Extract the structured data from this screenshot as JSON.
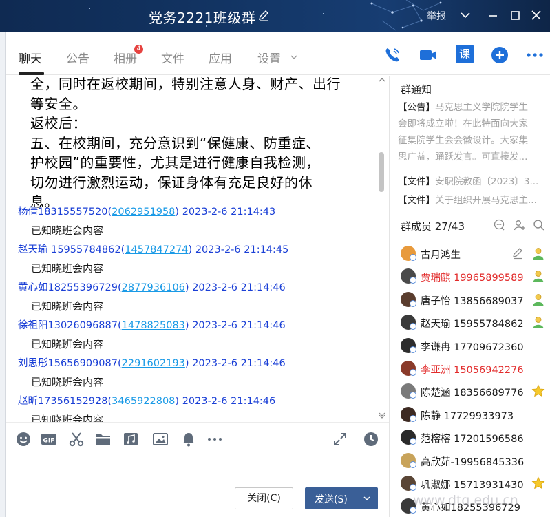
{
  "window": {
    "title": "党务2221班级群",
    "report_label": "举报"
  },
  "tabs": [
    {
      "label": "聊天",
      "active": true
    },
    {
      "label": "公告"
    },
    {
      "label": "相册",
      "badge": "4"
    },
    {
      "label": "文件"
    },
    {
      "label": "应用"
    },
    {
      "label": "设置"
    }
  ],
  "toolbar": {
    "class_label": "课"
  },
  "document_lines": [
    "全，同时在返校期间，特别注意人身、财产、出行",
    "等安全。",
    "返校后：",
    "五、在校期间，充分意识到“保健康、防重症、",
    "护校园”的重要性，尤其是进行健康自我检测，",
    "切勿进行激烈运动，保证身体有充足良好的休",
    "息。"
  ],
  "messages": [
    {
      "sender": "杨倩18315557520",
      "qq": "2062951958",
      "time": "2023-2-6 21:14:43",
      "text": "已知晓班会内容"
    },
    {
      "sender": "赵天瑜 15955784862",
      "qq": "1457847274",
      "time": "2023-2-6 21:14:45",
      "text": "已知晓班会内容"
    },
    {
      "sender": "黄心如18255396729",
      "qq": "2877936106",
      "time": "2023-2-6 21:14:46",
      "text": "已知晓班会内容"
    },
    {
      "sender": "徐祖阳13026096887",
      "qq": "1478825083",
      "time": "2023-2-6 21:14:46",
      "text": "已知晓班会内容"
    },
    {
      "sender": "刘思彤15656909087",
      "qq": "2291602193",
      "time": "2023-2-6 21:14:46",
      "text": "已知晓班会内容"
    },
    {
      "sender": "赵昕17356152928",
      "qq": "3465922808",
      "time": "2023-2-6 21:14:46",
      "text": "已知晓班会内容"
    }
  ],
  "input_bar": {
    "close_label": "关闭(C)",
    "send_label": "发送(S)"
  },
  "group_notice": {
    "title": "群通知",
    "announcement_tag": "【公告】",
    "announcement_lines": [
      "马克思主义学院院学生",
      "会即将成立啦！在此特面向大家",
      "征集院学生会会徽设计。大家集",
      "思广益，踊跃发言。可直接发..."
    ],
    "files": [
      {
        "tag": "【文件】",
        "name": "安职院教函〔2023〕3..."
      },
      {
        "tag": "【文件】",
        "name": "关于组织开展马克思主..."
      }
    ]
  },
  "members_panel": {
    "title": "群成员 27/43",
    "members": [
      {
        "name": "古月鸿生",
        "red": false,
        "role": "edit",
        "avatar_color": "#e89a3c"
      },
      {
        "name": "贾瑞麒 19965899589",
        "red": true,
        "role": "admin",
        "avatar_color": "#4a4a4a"
      },
      {
        "name": "唐子怡 13856689037",
        "red": false,
        "role": "admin",
        "avatar_color": "#5a3d2e"
      },
      {
        "name": "赵天瑜 15955784862",
        "red": false,
        "role": "admin",
        "avatar_color": "#3a3a3a"
      },
      {
        "name": "李谦冉 17709672360",
        "red": false,
        "role": "none",
        "avatar_color": "#2d2d2d"
      },
      {
        "name": "李亚洲  15056942276",
        "red": true,
        "role": "none",
        "avatar_color": "#8a3a2a"
      },
      {
        "name": "陈楚涵 18356689776",
        "red": false,
        "role": "star",
        "avatar_color": "#7a7a7a"
      },
      {
        "name": "陈静  17729933973",
        "red": false,
        "role": "none",
        "avatar_color": "#3d2a22"
      },
      {
        "name": "范榕榕 17201596586",
        "red": false,
        "role": "none",
        "avatar_color": "#2a2a2a"
      },
      {
        "name": "高欣茹-19956845336",
        "red": false,
        "role": "none",
        "avatar_color": "#c8a35a"
      },
      {
        "name": "巩淑娜 15713931430",
        "red": false,
        "role": "star",
        "avatar_color": "#5a4636"
      },
      {
        "name": "黄心如18255396729",
        "red": false,
        "role": "none",
        "avatar_color": "#3a3a3a"
      }
    ]
  },
  "watermark": "www.dtq.edu.cn"
}
